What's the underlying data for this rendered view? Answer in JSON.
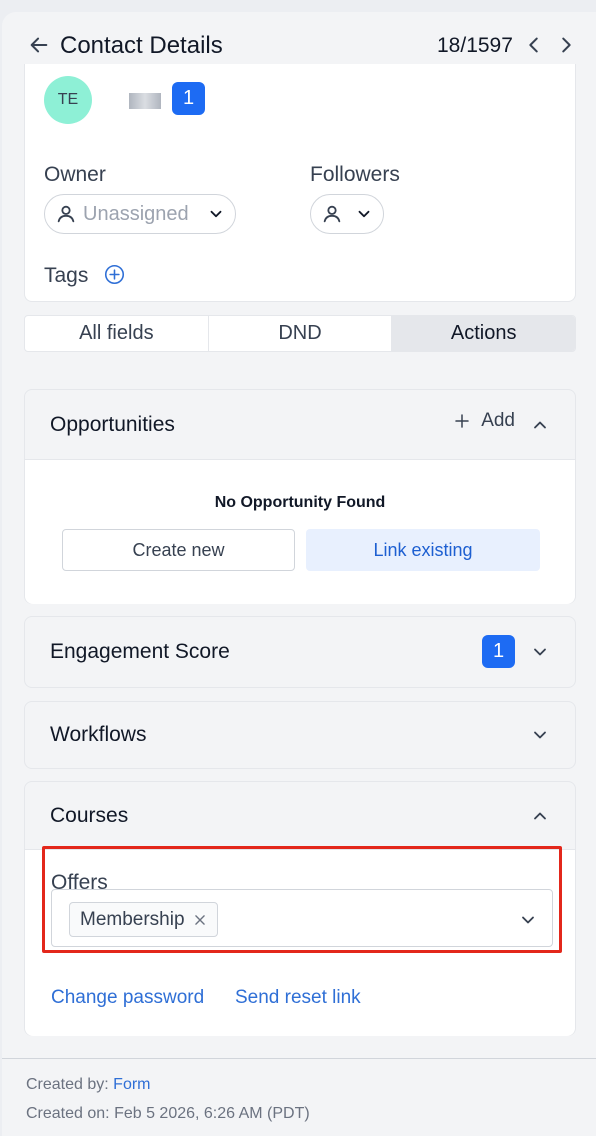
{
  "header": {
    "title": "Contact Details",
    "counter": "18/1597"
  },
  "contact": {
    "initials": "TE",
    "badge_count": "1",
    "owner_label": "Owner",
    "owner_value": "Unassigned",
    "followers_label": "Followers",
    "tags_label": "Tags"
  },
  "tabs": [
    {
      "label": "All fields",
      "active": false
    },
    {
      "label": "DND",
      "active": false
    },
    {
      "label": "Actions",
      "active": true
    }
  ],
  "opportunities": {
    "title": "Opportunities",
    "add_label": "Add",
    "empty_text": "No Opportunity Found",
    "create_new": "Create new",
    "link_existing": "Link existing"
  },
  "engagement": {
    "title": "Engagement Score",
    "badge": "1"
  },
  "workflows": {
    "title": "Workflows"
  },
  "courses": {
    "title": "Courses",
    "offers_label": "Offers",
    "selected_offers": [
      "Membership"
    ],
    "change_password": "Change password",
    "send_reset_link": "Send reset link"
  },
  "footer": {
    "created_by_label": "Created by:",
    "created_by_value": "Form",
    "created_on_label": "Created on:",
    "created_on_value": "Feb 5 2026, 6:26 AM (PDT)"
  },
  "colors": {
    "accent": "#1d6bf3",
    "link": "#2f6fd6",
    "avatar_bg": "#8ef0d6",
    "highlight": "#e3271b"
  },
  "icons": [
    "arrow-left-icon",
    "chevron-left-icon",
    "chevron-right-icon",
    "user-icon",
    "chevron-down-icon",
    "plus-circle-icon",
    "plus-icon",
    "chevron-up-icon",
    "close-icon"
  ]
}
